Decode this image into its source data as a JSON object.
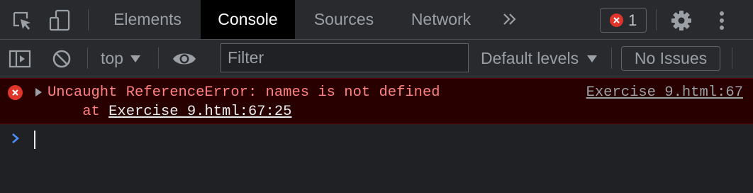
{
  "tabs": [
    {
      "label": "Elements",
      "active": false
    },
    {
      "label": "Console",
      "active": true
    },
    {
      "label": "Sources",
      "active": false
    },
    {
      "label": "Network",
      "active": false
    }
  ],
  "more_tabs_glyph": "»",
  "error_badge": {
    "count": "1"
  },
  "toolbar": {
    "context": "top",
    "filter_placeholder": "Filter",
    "levels_label": "Default levels",
    "issues_label": "No Issues"
  },
  "console": {
    "error": {
      "message": "Uncaught ReferenceError: names is not defined",
      "stack_prefix": "    at ",
      "stack_link": "Exercise 9.html:67:25",
      "source_link": "Exercise 9.html:67"
    }
  },
  "colors": {
    "error_red": "#e0352b",
    "error_text": "#ff8080",
    "error_bg": "#290000",
    "prompt_blue": "#4c8df6",
    "active_tab_bg": "#000000"
  }
}
